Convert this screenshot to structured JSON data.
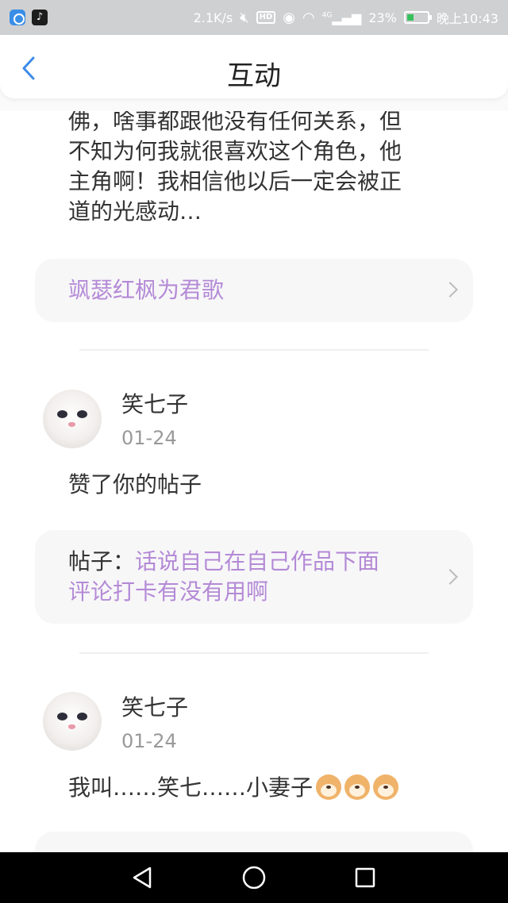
{
  "status_bar": {
    "network_speed": "2.1K/s",
    "network_type": "4G",
    "hd_label": "HD",
    "battery": "23%",
    "time": "晚上10:43"
  },
  "header": {
    "title": "互动"
  },
  "items": [
    {
      "comment_lines": [
        "佛，啥事都跟他没有任何关系，但",
        "不知为何我就很喜欢这个角色，他",
        "主角啊！我相信他以后一定会被正",
        "道的光感动…"
      ],
      "card_title": "飒瑟红枫为君歌"
    },
    {
      "username": "笑七子",
      "date": "01-24",
      "action": "赞了你的帖子",
      "card_prefix": "帖子：",
      "card_title_line1": "话说自己在自己作品下面",
      "card_title_line2": "评论打卡有没有用啊"
    },
    {
      "username": "笑七子",
      "date": "01-24",
      "comment": "我叫……笑七……小妻子"
    }
  ],
  "colors": {
    "accent_purple": "#b48ad6",
    "back_arrow_blue": "#3d8be8",
    "card_bg": "#f7f7f8"
  }
}
